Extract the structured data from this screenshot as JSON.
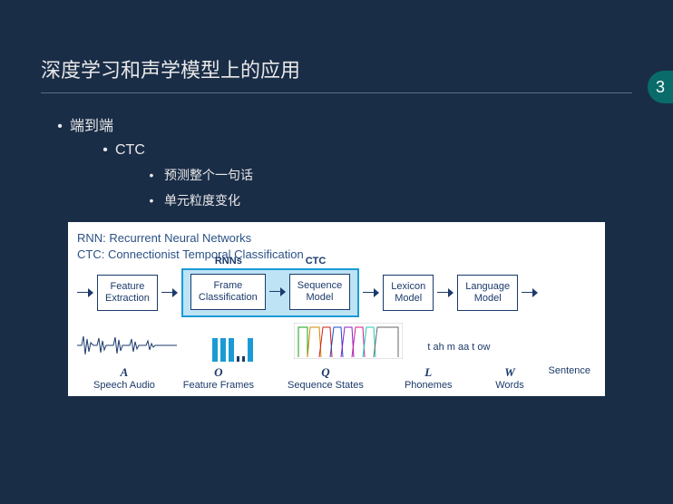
{
  "page_number": "3",
  "title": "深度学习和声学模型上的应用",
  "outline": {
    "l1": "端到端",
    "l2": "CTC",
    "l3a": "预测整个一句话",
    "l3b": "单元粒度变化"
  },
  "diagram": {
    "legend1": "RNN: Recurrent Neural Networks",
    "legend2": "CTC: Connectionist Temporal Classification",
    "group_label1": "RNNs",
    "group_label2": "CTC",
    "box_feature": "Feature\nExtraction",
    "box_frame": "Frame\nClassification",
    "box_seq": "Sequence\nModel",
    "box_lex": "Lexicon\nModel",
    "box_lang": "Language\nModel",
    "phoneme_example": "t ah m aa t ow",
    "labels": {
      "A": {
        "sym": "A",
        "name": "Speech Audio"
      },
      "O": {
        "sym": "O",
        "name": "Feature Frames"
      },
      "Q": {
        "sym": "Q",
        "name": "Sequence States"
      },
      "L": {
        "sym": "L",
        "name": "Phonemes"
      },
      "W": {
        "sym": "W",
        "name": "Words"
      },
      "S": {
        "sym": "",
        "name": "Sentence"
      }
    }
  }
}
